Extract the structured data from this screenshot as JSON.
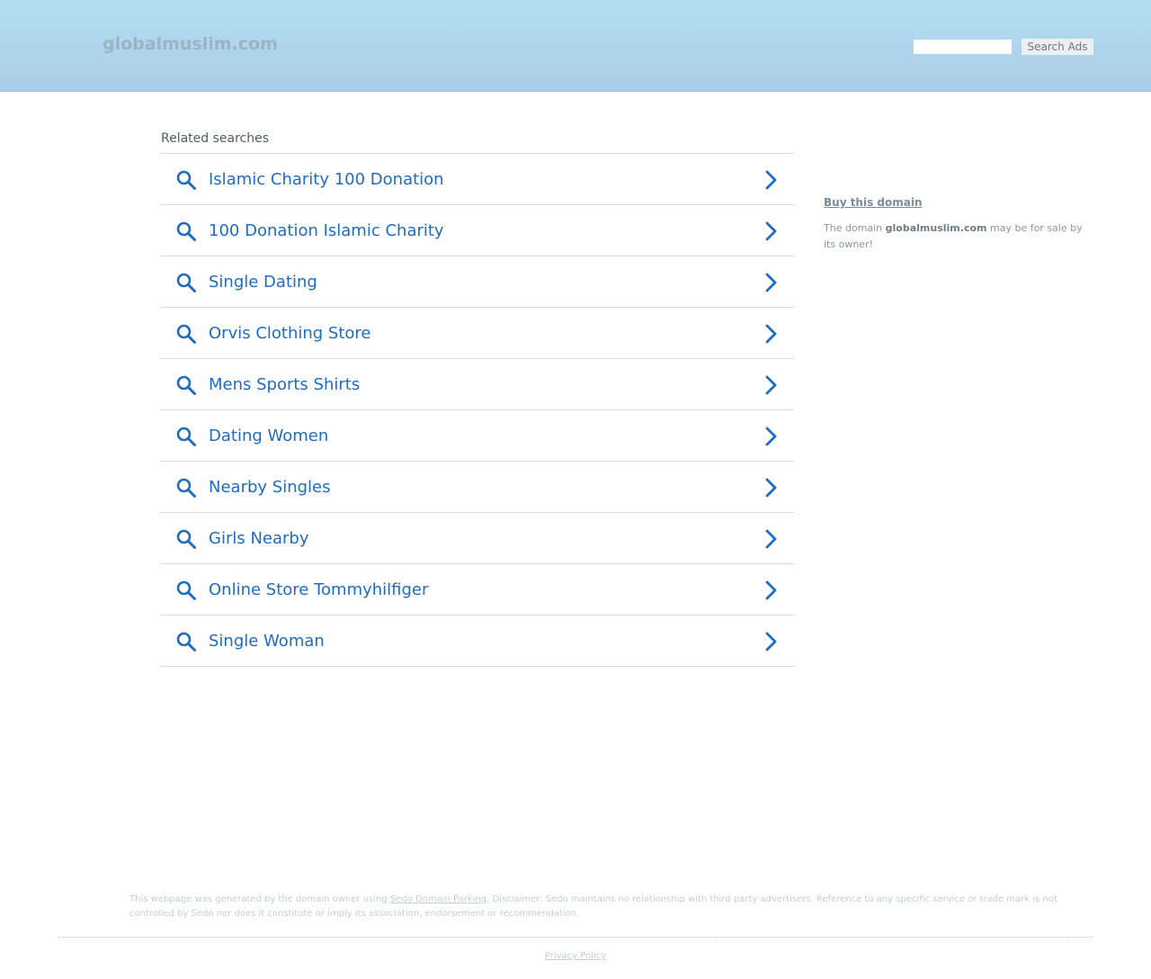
{
  "header": {
    "domain_title": "globalmuslim.com",
    "search_placeholder": "",
    "search_button_label": "Search Ads",
    "background_color": "#b5def2"
  },
  "related": {
    "heading": "Related searches",
    "link_color": "#1f6cc1",
    "icon": "search-icon",
    "arrow_icon": "chevron-right-icon",
    "items": [
      {
        "label": "Islamic Charity 100 Donation"
      },
      {
        "label": "100 Donation Islamic Charity"
      },
      {
        "label": "Single Dating"
      },
      {
        "label": "Orvis Clothing Store"
      },
      {
        "label": "Mens Sports Shirts"
      },
      {
        "label": "Dating Women"
      },
      {
        "label": "Nearby Singles"
      },
      {
        "label": "Girls Nearby"
      },
      {
        "label": "Online Store Tommyhilfiger"
      },
      {
        "label": "Single Woman"
      }
    ]
  },
  "sidebar": {
    "buy_link": "Buy this domain",
    "sale_prefix": "The domain ",
    "sale_domain": "globalmuslim.com",
    "sale_suffix": " may be for sale by its owner!"
  },
  "footer": {
    "disclaimer_prefix": "This webpage was generated by the domain owner using ",
    "disclaimer_link": "Sedo Domain Parking",
    "disclaimer_suffix": ". Disclaimer: Sedo maintains no relationship with third party advertisers. Reference to any specific service or trade mark is not controlled by Sedo nor does it constitute or imply its association, endorsement or recommendation.",
    "privacy_link": "Privacy Policy"
  }
}
